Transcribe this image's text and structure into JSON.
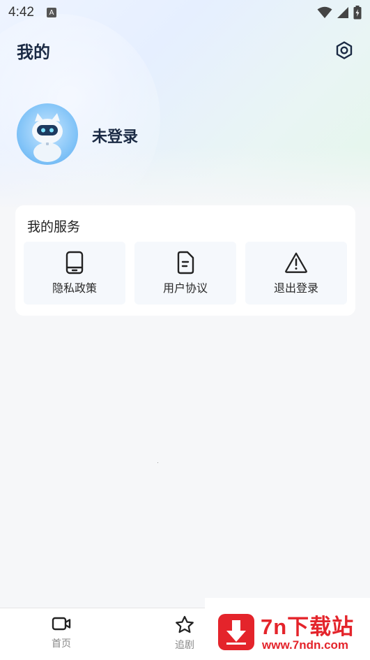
{
  "status_bar": {
    "time": "4:42",
    "keyboard_indicator": "A"
  },
  "header": {
    "title": "我的",
    "settings_icon": "settings-hexagon-icon"
  },
  "profile": {
    "name": "未登录",
    "avatar_icon": "robot-cat-avatar"
  },
  "services": {
    "title": "我的服务",
    "items": [
      {
        "label": "隐私政策",
        "icon": "tablet-icon"
      },
      {
        "label": "用户协议",
        "icon": "document-icon"
      },
      {
        "label": "退出登录",
        "icon": "warning-icon"
      }
    ]
  },
  "bottom_nav": {
    "items": [
      {
        "label": "首页",
        "icon": "video-icon"
      },
      {
        "label": "追剧",
        "icon": "star-icon"
      }
    ]
  },
  "watermark": {
    "title": "7n下载站",
    "url": "www.7ndn.com"
  },
  "colors": {
    "title_text": "#1b2a44",
    "watermark_red": "#e4242b",
    "nav_label": "#888888"
  }
}
